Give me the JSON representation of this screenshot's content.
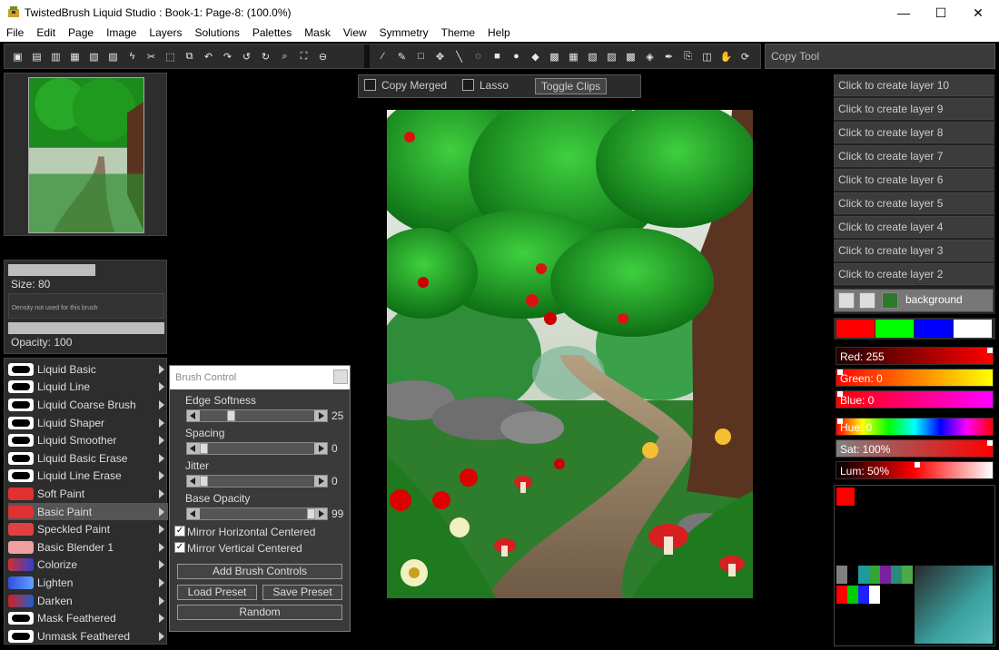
{
  "window": {
    "title": "TwistedBrush Liquid Studio : Book-1: Page-8:  (100.0%)",
    "minimize": "—",
    "maximize": "☐",
    "close": "✕"
  },
  "menu": [
    "File",
    "Edit",
    "Page",
    "Image",
    "Layers",
    "Solutions",
    "Palettes",
    "Mask",
    "View",
    "Symmetry",
    "Theme",
    "Help"
  ],
  "toolbar": {
    "left_icons": [
      "save-icon",
      "save-as-icon",
      "page-icon",
      "page-next-icon",
      "page-prev-icon",
      "page-dup-icon",
      "lightning-icon",
      "scissors-icon",
      "select-icon",
      "copy-icon",
      "rotate-left-icon",
      "rotate-right-icon",
      "undo-icon",
      "redo-icon",
      "zoom-icon",
      "fit-icon",
      "zoom-out-icon"
    ],
    "right_icons": [
      "brush-icon",
      "eyedropper-icon",
      "rect-select-icon",
      "move-icon",
      "line-icon",
      "lasso-icon",
      "rectangle-icon",
      "ellipse-icon",
      "diamond-icon",
      "gradient-icon",
      "checker-icon",
      "checker-2-icon",
      "checker-3-icon",
      "checker-4-icon",
      "checker-5-icon",
      "pen-icon",
      "copy-tool-icon",
      "layers-icon",
      "hand-icon",
      "reset-icon"
    ],
    "tool_name": "Copy Tool"
  },
  "canvas_options": {
    "copy_merged": "Copy Merged",
    "lasso": "Lasso",
    "toggle_clips": "Toggle Clips"
  },
  "brush_panel": {
    "size_label": "Size: 80",
    "size_value": 0.5,
    "density_note": "Density not used for this brush",
    "opacity_label": "Opacity: 100",
    "opacity_value": 1.0
  },
  "brushes": [
    {
      "label": "Liquid Basic",
      "selected": false
    },
    {
      "label": "Liquid Line",
      "selected": false
    },
    {
      "label": "Liquid Coarse Brush",
      "selected": false
    },
    {
      "label": "Liquid Shaper",
      "selected": false
    },
    {
      "label": "Liquid Smoother",
      "selected": false
    },
    {
      "label": "Liquid Basic Erase",
      "selected": false
    },
    {
      "label": "Liquid Line Erase",
      "selected": false
    },
    {
      "label": "Soft Paint",
      "selected": false
    },
    {
      "label": "Basic Paint",
      "selected": true
    },
    {
      "label": "Speckled Paint",
      "selected": false
    },
    {
      "label": "Basic Blender 1",
      "selected": false
    },
    {
      "label": "Colorize",
      "selected": false
    },
    {
      "label": "Lighten",
      "selected": false
    },
    {
      "label": "Darken",
      "selected": false
    },
    {
      "label": "Mask Feathered",
      "selected": false
    },
    {
      "label": "Unmask Feathered",
      "selected": false
    }
  ],
  "brush_control": {
    "title": "Brush Control",
    "sliders": [
      {
        "label": "Edge Softness",
        "value": "25",
        "fraction": 0.25
      },
      {
        "label": "Spacing",
        "value": "0",
        "fraction": 0.0
      },
      {
        "label": "Jitter",
        "value": "0",
        "fraction": 0.0
      },
      {
        "label": "Base Opacity",
        "value": "99",
        "fraction": 0.99
      }
    ],
    "mirror_horizontal": "Mirror Horizontal Centered",
    "mirror_vertical": "Mirror Vertical Centered",
    "add_controls": "Add Brush Controls",
    "load_preset": "Load Preset",
    "save_preset": "Save Preset",
    "random": "Random"
  },
  "layers": [
    "Click to create layer 10",
    "Click to create layer 9",
    "Click to create layer 8",
    "Click to create layer 7",
    "Click to create layer 6",
    "Click to create layer 5",
    "Click to create layer 4",
    "Click to create layer 3",
    "Click to create layer 2"
  ],
  "active_layer": "background",
  "swatches": [
    "#ff0000",
    "#00ff00",
    "#0000ff",
    "#ffffff"
  ],
  "color_sliders": {
    "red": "Red: 255",
    "green": "Green: 0",
    "blue": "Blue: 0",
    "hue": "Hue: 0",
    "sat": "Sat: 100%",
    "lum": "Lum: 50%"
  },
  "current_color": "#ff0000"
}
